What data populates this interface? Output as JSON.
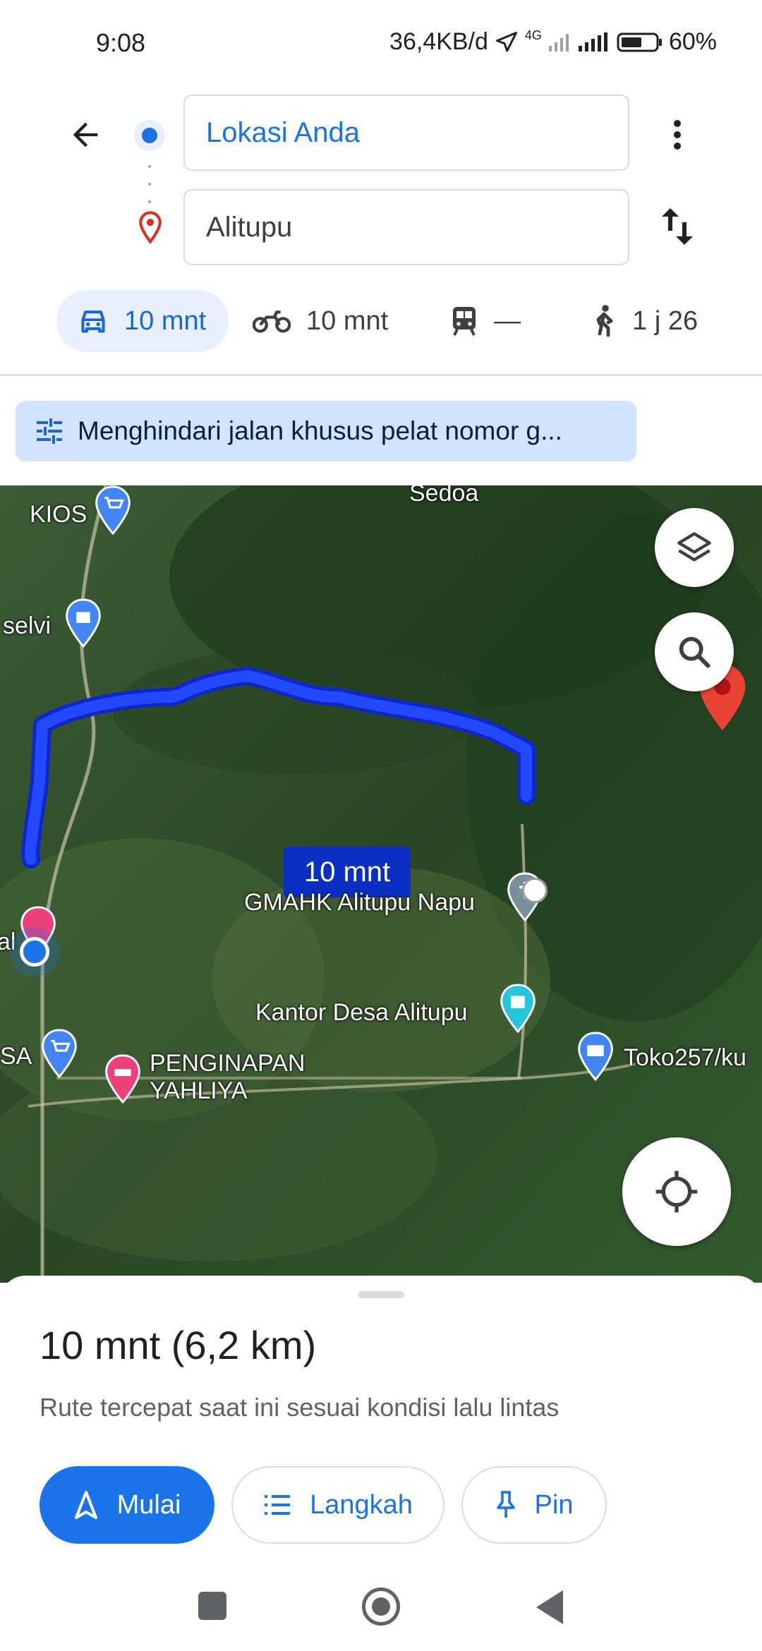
{
  "status_bar": {
    "time": "9:08",
    "network_speed": "36,4KB/d",
    "network_type": "4G",
    "battery": "60%"
  },
  "directions": {
    "origin": "Lokasi Anda",
    "destination": "Alitupu",
    "modes": [
      {
        "name": "car-icon",
        "label": "10 mnt",
        "selected": true
      },
      {
        "name": "motorcycle-icon",
        "label": "10 mnt",
        "selected": false
      },
      {
        "name": "transit-icon",
        "label": "—",
        "selected": false
      },
      {
        "name": "walk-icon",
        "label": "1 j 26",
        "selected": false
      }
    ]
  },
  "option_chip": {
    "label": "Menghindari jalan khusus pelat nomor g..."
  },
  "map": {
    "labels": {
      "sedoa": "Sedoa",
      "kios": "KIOS",
      "selvi": "selvi",
      "gmahk": "GMAHK Alitupu Napu",
      "kantor": "Kantor Desa Alitupu",
      "sa": "SA",
      "penginapan": "PENGINAPAN\nYAHLIYA",
      "toko": "Toko257/ku",
      "al": "al"
    },
    "route_label": "10 mnt",
    "colors": {
      "route": "#1a3cff",
      "route_badge": "#0a2fc2",
      "destination_pin": "#ea4335"
    }
  },
  "sheet": {
    "summary": "10 mnt (6,2 km)",
    "subtitle": "Rute tercepat saat ini sesuai kondisi lalu lintas",
    "start_label": "Mulai",
    "steps_label": "Langkah",
    "pin_label": "Pin"
  }
}
